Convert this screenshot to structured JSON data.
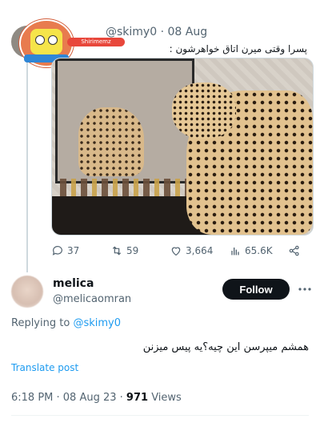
{
  "tweet1": {
    "handle": "@skimy0",
    "date": "· 08 Aug",
    "text": "پسرا وقتی میرن اتاق خواهرشون :",
    "watermark_banner": "Shirimemz",
    "stats": {
      "replies": "37",
      "retweets": "59",
      "likes": "3,664",
      "views": "65.6K"
    }
  },
  "tweet2": {
    "name": "melica",
    "handle": "@melicaomran",
    "follow_label": "Follow",
    "replying_prefix": "Replying to",
    "replying_handle": "@skimy0",
    "text": "همشم میپرسن این چیه؟یه پیس میزنن",
    "translate_label": "Translate post",
    "timestamp": "6:18 PM · 08 Aug 23 ·",
    "views_count": "971",
    "views_label": "Views"
  },
  "colors": {
    "accent": "#1d9bf0",
    "text": "#0f1419",
    "muted": "#536471",
    "button": "#0f1419"
  }
}
